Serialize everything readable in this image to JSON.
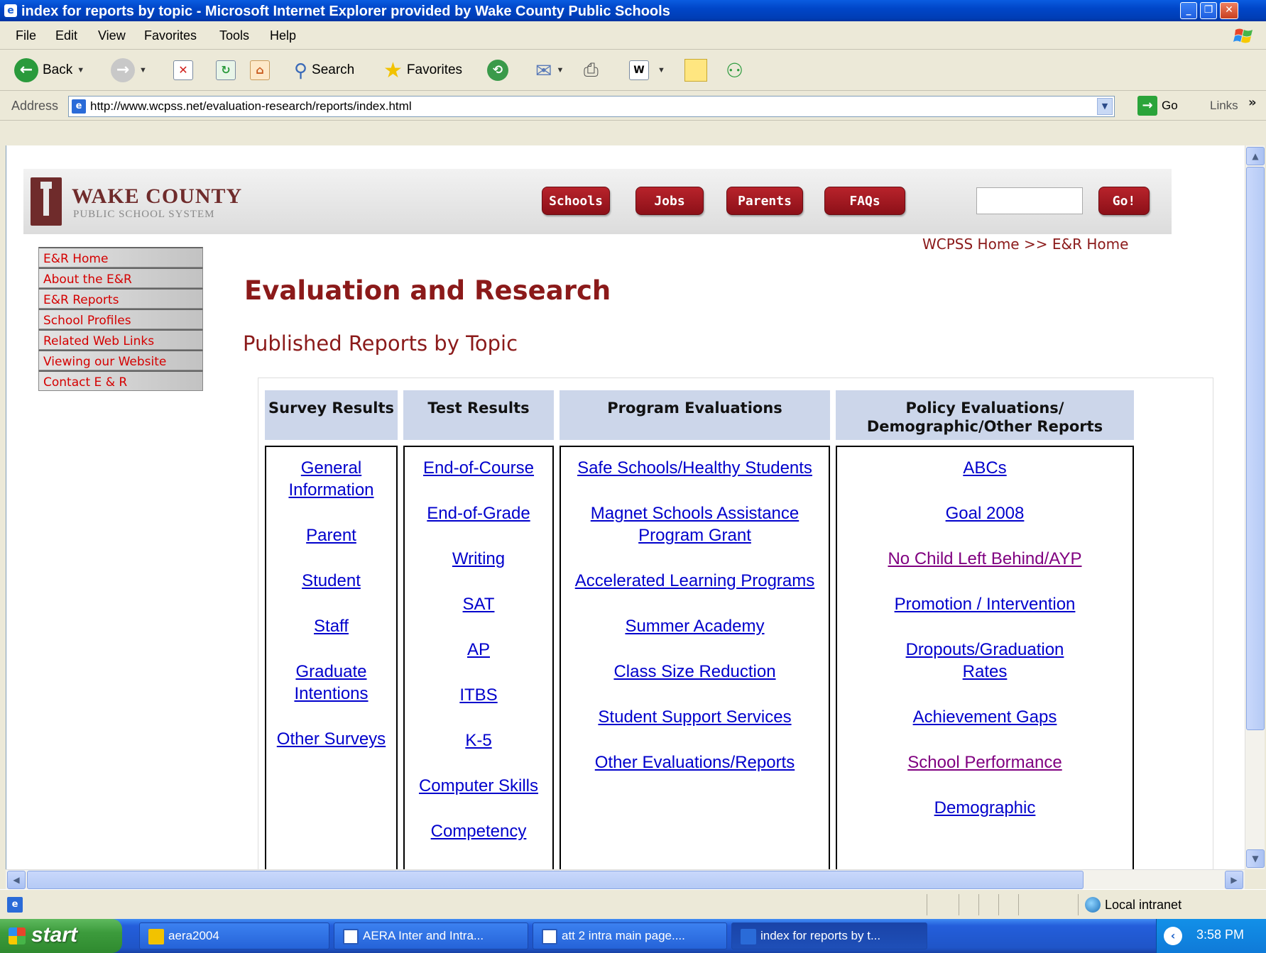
{
  "window": {
    "title": "index for reports by topic - Microsoft Internet Explorer provided by Wake County Public Schools"
  },
  "menu": [
    "File",
    "Edit",
    "View",
    "Favorites",
    "Tools",
    "Help"
  ],
  "toolbar": {
    "back": "Back",
    "search": "Search",
    "favorites": "Favorites"
  },
  "address": {
    "label": "Address",
    "url": "http://www.wcpss.net/evaluation-research/reports/index.html",
    "go": "Go",
    "links": "Links",
    "chevron": "»"
  },
  "banner": {
    "logo_title": "WAKE COUNTY",
    "logo_subtitle": "PUBLIC SCHOOL SYSTEM",
    "nav": [
      "Schools",
      "Jobs",
      "Parents",
      "FAQs"
    ],
    "search_value": "",
    "go_label": "Go!"
  },
  "breadcrumb": {
    "home": "WCPSS Home",
    "sep": ">>",
    "current": "E&R Home"
  },
  "leftnav": [
    "E&R Home",
    "About the E&R",
    "E&R Reports",
    "School Profiles",
    "Related Web Links",
    "Viewing our Website",
    "Contact E & R"
  ],
  "page": {
    "title": "Evaluation and Research",
    "subtitle": "Published Reports by Topic"
  },
  "table": {
    "headers": [
      "Survey Results",
      "Test Results",
      "Program Evaluations",
      "Policy Evaluations/ Demographic/Other Reports"
    ],
    "survey": [
      "General Information",
      "Parent",
      "Student",
      "Staff",
      "Graduate Intentions",
      "Other Surveys"
    ],
    "test": [
      "End-of-Course",
      "End-of-Grade",
      "Writing",
      "SAT",
      "AP",
      "ITBS",
      "K-5",
      "Computer Skills",
      "Competency"
    ],
    "program": [
      "Safe Schools/Healthy Students",
      "Magnet Schools Assistance Program Grant",
      "Accelerated Learning Programs",
      "Summer Academy",
      "Class Size Reduction",
      "Student Support Services",
      "Other Evaluations/Reports"
    ],
    "policy": [
      "ABCs",
      "Goal 2008",
      "No Child Left Behind/AYP",
      "Promotion / Intervention",
      "Dropouts/Graduation Rates",
      "Achievement Gaps",
      "School Performance",
      "Demographic"
    ]
  },
  "status": {
    "zone": "Local intranet"
  },
  "taskbar": {
    "start": "start",
    "tasks": [
      "aera2004",
      "AERA Inter and Intra...",
      "att 2 intra main page....",
      "index for reports by t..."
    ],
    "clock": "3:58 PM"
  }
}
